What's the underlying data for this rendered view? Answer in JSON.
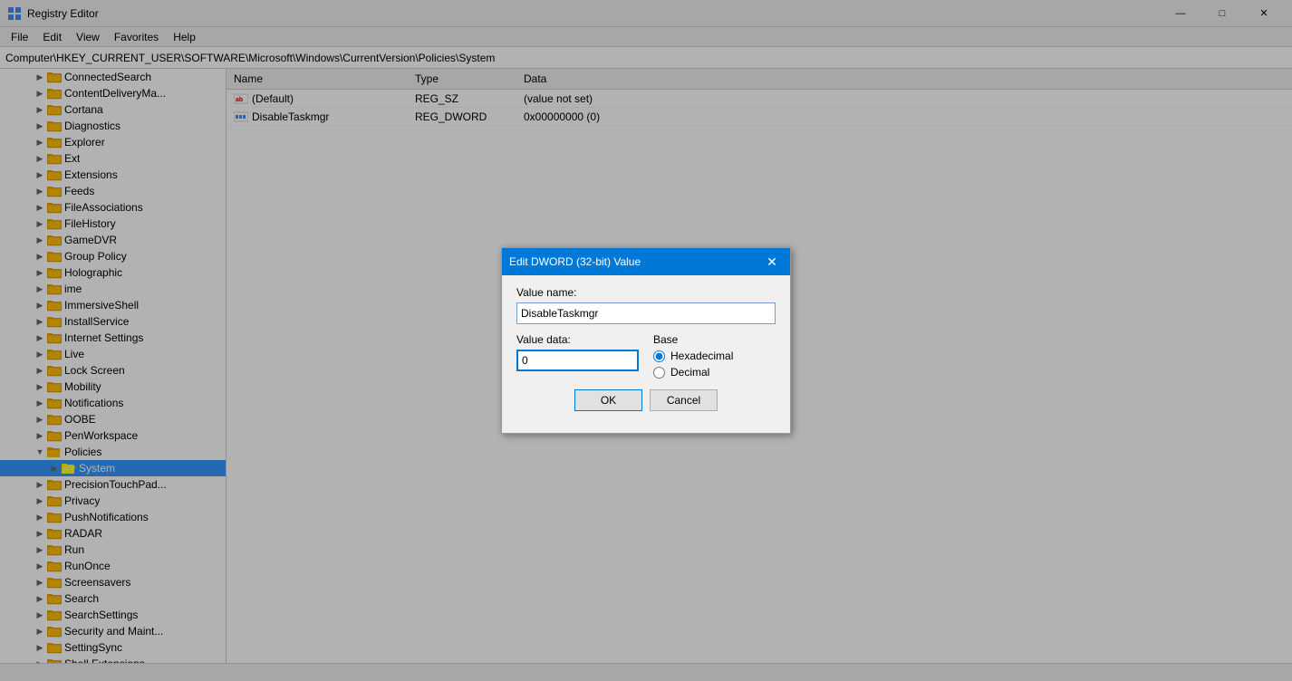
{
  "titlebar": {
    "icon": "registry-editor-icon",
    "title": "Registry Editor",
    "min_label": "—",
    "max_label": "□",
    "close_label": "✕"
  },
  "menubar": {
    "items": [
      "File",
      "Edit",
      "View",
      "Favorites",
      "Help"
    ]
  },
  "addressbar": {
    "path": "Computer\\HKEY_CURRENT_USER\\SOFTWARE\\Microsoft\\Windows\\CurrentVersion\\Policies\\System"
  },
  "tree": {
    "items": [
      {
        "label": "ConnectedSearch",
        "indent": "indent-2",
        "expanded": false
      },
      {
        "label": "ContentDeliveryMa...",
        "indent": "indent-2",
        "expanded": false
      },
      {
        "label": "Cortana",
        "indent": "indent-2",
        "expanded": false
      },
      {
        "label": "Diagnostics",
        "indent": "indent-2",
        "expanded": false
      },
      {
        "label": "Explorer",
        "indent": "indent-2",
        "expanded": false
      },
      {
        "label": "Ext",
        "indent": "indent-2",
        "expanded": false
      },
      {
        "label": "Extensions",
        "indent": "indent-2",
        "expanded": false
      },
      {
        "label": "Feeds",
        "indent": "indent-2",
        "expanded": false
      },
      {
        "label": "FileAssociations",
        "indent": "indent-2",
        "expanded": false
      },
      {
        "label": "FileHistory",
        "indent": "indent-2",
        "expanded": false
      },
      {
        "label": "GameDVR",
        "indent": "indent-2",
        "expanded": false
      },
      {
        "label": "Group Policy",
        "indent": "indent-2",
        "expanded": false
      },
      {
        "label": "Holographic",
        "indent": "indent-2",
        "expanded": false
      },
      {
        "label": "ime",
        "indent": "indent-2",
        "expanded": false
      },
      {
        "label": "ImmersiveShell",
        "indent": "indent-2",
        "expanded": false
      },
      {
        "label": "InstallService",
        "indent": "indent-2",
        "expanded": false
      },
      {
        "label": "Internet Settings",
        "indent": "indent-2",
        "expanded": false
      },
      {
        "label": "Live",
        "indent": "indent-2",
        "expanded": false
      },
      {
        "label": "Lock Screen",
        "indent": "indent-2",
        "expanded": false
      },
      {
        "label": "Mobility",
        "indent": "indent-2",
        "expanded": false
      },
      {
        "label": "Notifications",
        "indent": "indent-2",
        "expanded": false
      },
      {
        "label": "OOBE",
        "indent": "indent-2",
        "expanded": false
      },
      {
        "label": "PenWorkspace",
        "indent": "indent-2",
        "expanded": false
      },
      {
        "label": "Policies",
        "indent": "indent-2",
        "expanded": true
      },
      {
        "label": "System",
        "indent": "indent-3",
        "expanded": false,
        "selected": true
      },
      {
        "label": "PrecisionTouchPad...",
        "indent": "indent-2",
        "expanded": false
      },
      {
        "label": "Privacy",
        "indent": "indent-2",
        "expanded": false
      },
      {
        "label": "PushNotifications",
        "indent": "indent-2",
        "expanded": false
      },
      {
        "label": "RADAR",
        "indent": "indent-2",
        "expanded": false
      },
      {
        "label": "Run",
        "indent": "indent-2",
        "expanded": false
      },
      {
        "label": "RunOnce",
        "indent": "indent-2",
        "expanded": false
      },
      {
        "label": "Screensavers",
        "indent": "indent-2",
        "expanded": false
      },
      {
        "label": "Search",
        "indent": "indent-2",
        "expanded": false
      },
      {
        "label": "SearchSettings",
        "indent": "indent-2",
        "expanded": false
      },
      {
        "label": "Security and Maint...",
        "indent": "indent-2",
        "expanded": false
      },
      {
        "label": "SettingSync",
        "indent": "indent-2",
        "expanded": false
      },
      {
        "label": "Shell Extensions",
        "indent": "indent-2",
        "expanded": false
      }
    ]
  },
  "detail": {
    "columns": [
      "Name",
      "Type",
      "Data"
    ],
    "rows": [
      {
        "icon": "ab-icon",
        "name": "(Default)",
        "type": "REG_SZ",
        "data": "(value not set)"
      },
      {
        "icon": "dword-icon",
        "name": "DisableTaskmgr",
        "type": "REG_DWORD",
        "data": "0x00000000 (0)"
      }
    ]
  },
  "dialog": {
    "title": "Edit DWORD (32-bit) Value",
    "value_name_label": "Value name:",
    "value_name": "DisableTaskmgr",
    "value_data_label": "Value data:",
    "value_data": "0",
    "base_label": "Base",
    "base_options": [
      {
        "label": "Hexadecimal",
        "value": "hex",
        "selected": true
      },
      {
        "label": "Decimal",
        "value": "dec",
        "selected": false
      }
    ],
    "ok_label": "OK",
    "cancel_label": "Cancel"
  },
  "statusbar": {
    "text": ""
  }
}
